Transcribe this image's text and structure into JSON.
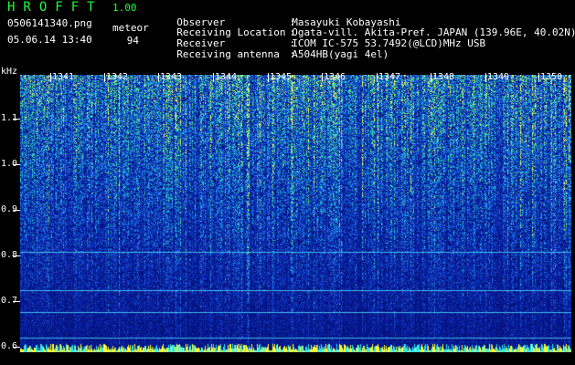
{
  "header": {
    "app_title": "HROFFT",
    "version": "1.00",
    "filename": "0506141340.png",
    "datetime": "05.06.14 13:40",
    "meteor_label": "meteor",
    "meteor_count": "94"
  },
  "info": [
    {
      "key": "Observer",
      "value": "Masayuki Kobayashi"
    },
    {
      "key": "Receiving Location",
      "value": "Ogata-vill. Akita-Pref. JAPAN (139.96E, 40.02N)"
    },
    {
      "key": "Receiver",
      "value": "ICOM IC-575 53.7492(@LCD)MHz USB"
    },
    {
      "key": "Receiving antenna",
      "value": "A504HB(yagi 4el)"
    }
  ],
  "axes": {
    "y_unit": "kHz",
    "y_ticks": [
      "1.1",
      "1.0",
      "0.9",
      "0.8",
      "0.7",
      "0.6"
    ],
    "x_ticks": [
      "1341",
      "1342",
      "1343",
      "1344",
      "1345",
      "1346",
      "1347",
      "1348",
      "1349",
      "1350"
    ]
  },
  "colors": {
    "background": "#000000",
    "title_green": "#19ff37",
    "spectrogram_base": "#061a8a",
    "signal_cyan": "#30e0e0",
    "signal_yellow": "#ffff40"
  }
}
